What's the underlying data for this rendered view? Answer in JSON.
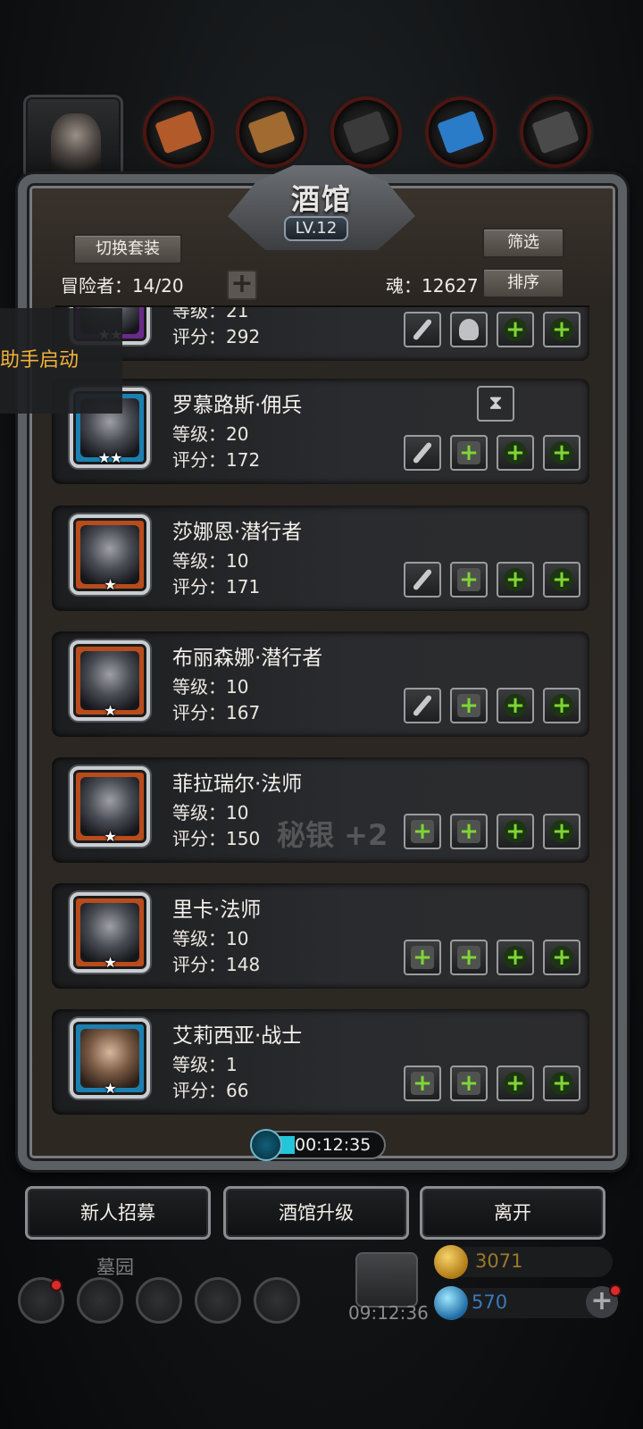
{
  "colors": {
    "accent_green": "#7ed634",
    "assistant_text": "#f2b23a",
    "timer_fill": "#22c6d8"
  },
  "top_tabs": [
    {
      "name": "character-portrait-tab",
      "icon": "hooded-figure-icon"
    },
    {
      "name": "ore-category",
      "icon": "copper-ore-icon",
      "color": "#b25a2a"
    },
    {
      "name": "wood-category",
      "icon": "wood-plank-icon",
      "color": "#a06a30"
    },
    {
      "name": "iron-category",
      "icon": "iron-ingot-icon",
      "color": "#3a3a3a"
    },
    {
      "name": "crystal-category",
      "icon": "crystal-icon",
      "color": "#2b7cc8"
    },
    {
      "name": "steel-category",
      "icon": "steel-ingot-icon",
      "color": "#4a4a4a"
    }
  ],
  "panel": {
    "title": "酒馆",
    "level": "LV.12",
    "switch_set": "切换套装",
    "filter": "筛选",
    "sort": "排序",
    "adventurers": "冒险者：14/20",
    "soul": "魂：12627",
    "add": "+"
  },
  "assistant_toast": "助手启动",
  "heroes": [
    {
      "name": "",
      "level": "等级：21",
      "score": "评分：292",
      "stars": "★★",
      "frame": "purple",
      "partial": true,
      "slots": [
        "blade",
        "helm",
        "plus",
        "plus"
      ]
    },
    {
      "name": "罗慕路斯·佣兵",
      "level": "等级：20",
      "score": "评分：172",
      "stars": "★★",
      "frame": "blue",
      "timer": "⧗",
      "slots": [
        "blade",
        "plus-sq",
        "plus",
        "plus"
      ]
    },
    {
      "name": "莎娜恩·潜行者",
      "level": "等级：10",
      "score": "评分：171",
      "stars": "★",
      "frame": "orange",
      "slots": [
        "blade",
        "plus-sq",
        "plus",
        "plus"
      ]
    },
    {
      "name": "布丽森娜·潜行者",
      "level": "等级：10",
      "score": "评分：167",
      "stars": "★",
      "frame": "orange",
      "slots": [
        "blade",
        "plus-sq",
        "plus",
        "plus"
      ]
    },
    {
      "name": "菲拉瑞尔·法师",
      "level": "等级：10",
      "score": "评分：150",
      "stars": "★",
      "frame": "orange",
      "ghost": "秘银 +2",
      "slots": [
        "plus-sq",
        "plus-sq",
        "plus",
        "plus"
      ]
    },
    {
      "name": "里卡·法师",
      "level": "等级：10",
      "score": "评分：148",
      "stars": "★",
      "frame": "orange",
      "slots": [
        "plus-sq",
        "plus-sq",
        "plus",
        "plus"
      ]
    },
    {
      "name": "艾莉西亚·战士",
      "level": "等级：1",
      "score": "评分：66",
      "stars": "★",
      "frame": "blue",
      "slots": [
        "plus-sq",
        "plus-sq",
        "plus",
        "plus"
      ]
    }
  ],
  "timer": {
    "value": "00:12:35",
    "progress": 0.15
  },
  "bottom_buttons": {
    "recruit": "新人招募",
    "upgrade": "酒馆升级",
    "leave": "离开"
  },
  "hud": {
    "graveyard": "墓园",
    "gift_timer": "09:12:36",
    "gold": "3071",
    "gems": "570"
  }
}
